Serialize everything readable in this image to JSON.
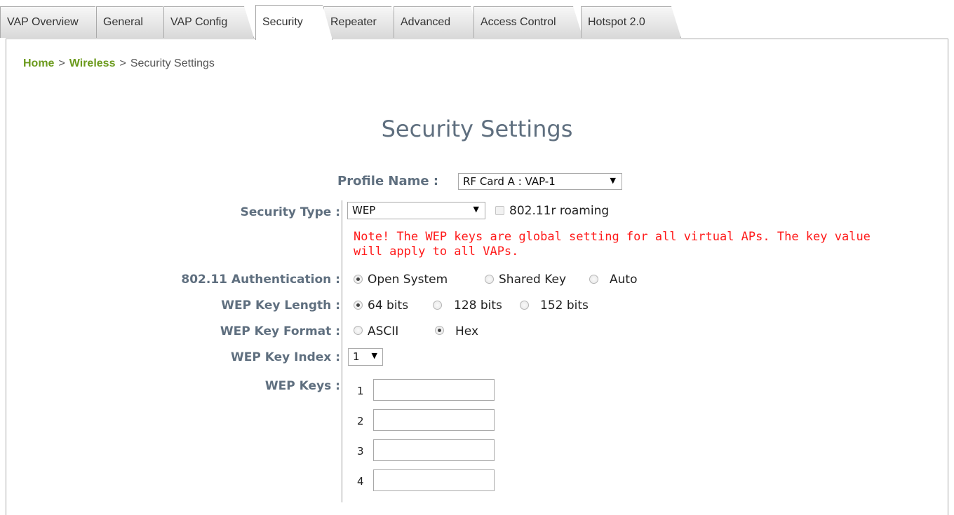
{
  "tabs": [
    {
      "label": "VAP Overview"
    },
    {
      "label": "General"
    },
    {
      "label": "VAP Config"
    },
    {
      "label": "Security"
    },
    {
      "label": "Repeater"
    },
    {
      "label": "Advanced"
    },
    {
      "label": "Access Control"
    },
    {
      "label": "Hotspot 2.0"
    }
  ],
  "active_tab": "Security",
  "breadcrumb": {
    "home": "Home",
    "sep1": ">",
    "wireless": "Wireless",
    "sep2": ">",
    "current": "Security Settings"
  },
  "page_title": "Security Settings",
  "profile": {
    "label": "Profile Name :",
    "value": "RF Card A : VAP-1"
  },
  "security_type": {
    "label": "Security Type :",
    "value": "WEP",
    "roaming_label": "802.11r roaming",
    "roaming_checked": false
  },
  "note": "Note! The WEP keys are global setting for all virtual APs. The key value will apply to all VAPs.",
  "authentication": {
    "label": "802.11 Authentication :",
    "options": [
      "Open System",
      "Shared Key",
      "Auto"
    ],
    "selected": "Open System"
  },
  "key_length": {
    "label": "WEP Key Length :",
    "options": [
      "64 bits",
      "128 bits",
      "152 bits"
    ],
    "selected": "64 bits"
  },
  "key_format": {
    "label": "WEP Key Format :",
    "options": [
      "ASCII",
      "Hex"
    ],
    "selected": "Hex"
  },
  "key_index": {
    "label": "WEP Key Index :",
    "value": "1"
  },
  "wep_keys": {
    "label": "WEP Keys :",
    "items": [
      {
        "num": "1",
        "value": ""
      },
      {
        "num": "2",
        "value": ""
      },
      {
        "num": "3",
        "value": ""
      },
      {
        "num": "4",
        "value": ""
      }
    ]
  },
  "colors": {
    "link_green": "#6b9a1c",
    "label_slate": "#5f6f7f",
    "note_red": "#ff1a1a"
  },
  "icons": {
    "dropdown": "triangle-down-icon"
  }
}
